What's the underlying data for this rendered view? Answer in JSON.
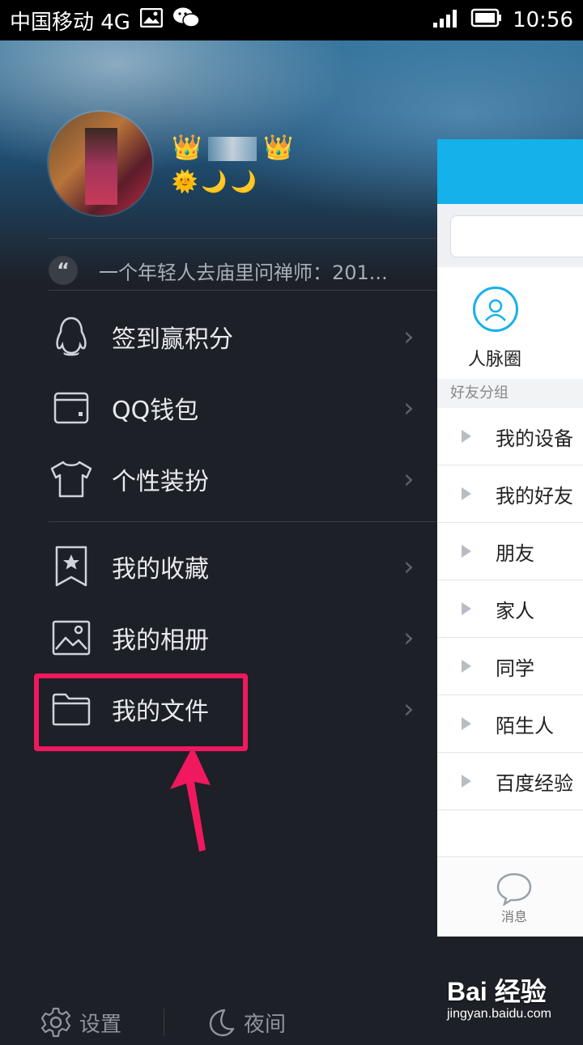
{
  "status_bar": {
    "carrier": "中国移动 4G",
    "time": "10:56"
  },
  "profile": {
    "crown_left": "👑",
    "crown_right": "👑",
    "weather": "🌞🌙🌙",
    "signature": "一个年轻人去庙里问禅师：201..."
  },
  "menu": [
    {
      "label": "签到赢积分",
      "icon": "penguin-icon"
    },
    {
      "label": "QQ钱包",
      "icon": "wallet-icon"
    },
    {
      "label": "个性装扮",
      "icon": "tshirt-icon"
    },
    {
      "label": "我的收藏",
      "icon": "bookmark-star-icon"
    },
    {
      "label": "我的相册",
      "icon": "picture-icon"
    },
    {
      "label": "我的文件",
      "icon": "folder-icon"
    }
  ],
  "bottom": {
    "settings_label": "设置",
    "night_label": "夜间"
  },
  "main": {
    "circle_label": "人脉圈",
    "group_header": "好友分组",
    "groups": [
      "我的设备",
      "我的好友",
      "朋友",
      "家人",
      "同学",
      "陌生人",
      "百度经验"
    ],
    "tab_message": "消息"
  },
  "watermark": {
    "brand": "Bai 经验",
    "url": "jingyan.baidu.com"
  },
  "colors": {
    "highlight": "#f0185e",
    "header_blue": "#14b1ea",
    "drawer_bg": "#1d2026"
  }
}
